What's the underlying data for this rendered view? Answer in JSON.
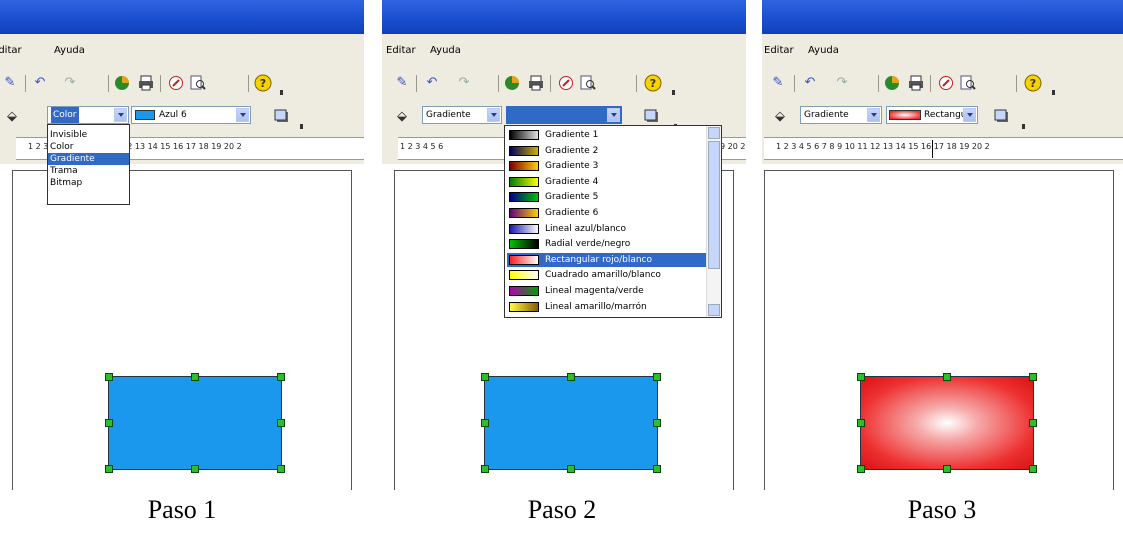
{
  "menu": {
    "edit": "Editar",
    "help": "Ayuda"
  },
  "ruler": {
    "p1": "1  2  3  4  5  6  7  8  9  10 11 12 13 14 15 16 17 18 19 20 2",
    "p2": "1  2  3  4  5  6",
    "p2_tail": "9 20 2",
    "p3": "1  2  3  4  5  6  7  8  9  10 11 12 13 14 15 16 17 18 19 20 2"
  },
  "step1": {
    "fill_type": "Color",
    "fill_value": "Azul 6",
    "options": [
      "Invisible",
      "Color",
      "Gradiente",
      "Trama",
      "Bitmap"
    ],
    "highlighted": "Gradiente",
    "caption": "Paso 1"
  },
  "step2": {
    "fill_type": "Gradiente",
    "gradients": [
      {
        "name": "Gradiente 1",
        "colors": [
          "#000000",
          "#e0e0e0"
        ]
      },
      {
        "name": "Gradiente 2",
        "colors": [
          "#000060",
          "#d0b000"
        ]
      },
      {
        "name": "Gradiente 3",
        "colors": [
          "#800000",
          "#ffd000"
        ]
      },
      {
        "name": "Gradiente 4",
        "colors": [
          "#008000",
          "#ffff00"
        ]
      },
      {
        "name": "Gradiente 5",
        "colors": [
          "#000090",
          "#00c000"
        ]
      },
      {
        "name": "Gradiente 6",
        "colors": [
          "#600080",
          "#ffd000"
        ]
      },
      {
        "name": "Lineal azul/blanco",
        "colors": [
          "#1a1ab0",
          "#ffffff"
        ]
      },
      {
        "name": "Radial verde/negro",
        "colors": [
          "#00c000",
          "#000000"
        ]
      },
      {
        "name": "Rectangular rojo/blanco",
        "colors": [
          "#ff2020",
          "#ffffff"
        ]
      },
      {
        "name": "Cuadrado amarillo/blanco",
        "colors": [
          "#ffff00",
          "#ffffff"
        ]
      },
      {
        "name": "Lineal magenta/verde",
        "colors": [
          "#b000b0",
          "#00a000"
        ]
      },
      {
        "name": "Lineal amarillo/marrón",
        "colors": [
          "#ffff40",
          "#8b5a00"
        ]
      }
    ],
    "highlighted": "Rectangular rojo/blanco",
    "caption": "Paso 2"
  },
  "step3": {
    "fill_type": "Gradiente",
    "fill_value": "Rectangula",
    "caption": "Paso 3"
  },
  "colors": {
    "shape_blue": "#1a98ee",
    "shape_red": "#ee3030",
    "titlebar": "#1a4fd1",
    "selection": "#3169c6"
  },
  "icons": [
    "brush-icon",
    "undo-icon",
    "redo-icon",
    "chart-icon",
    "printer-icon",
    "navigator-icon",
    "zoom-icon",
    "help-icon",
    "area-fill-icon",
    "shadow-icon"
  ]
}
